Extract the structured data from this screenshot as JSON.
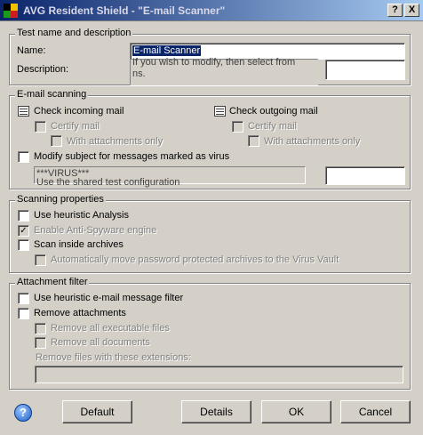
{
  "window": {
    "title": "AVG Resident Shield - \"E-mail Scanner\"",
    "help_label": "?",
    "close_label": "X"
  },
  "test_name": {
    "legend": "Test name and description",
    "name_label": "Name:",
    "name_value": "E-mail Scanner",
    "description_label": "Description:",
    "description_ghost_1": "If you wish to modify, then select from",
    "description_ghost_2": "ns."
  },
  "email_scanning": {
    "legend": "E-mail scanning",
    "check_incoming": "Check incoming mail",
    "check_outgoing": "Check outgoing mail",
    "certify_mail_in": "Certify mail",
    "certify_mail_out": "Certify mail",
    "with_attachments_in": "With attachments only",
    "with_attachments_out": "With attachments only",
    "modify_subject": "Modify subject for messages marked as virus",
    "subject_value": "***VIRUS***",
    "ghost_shared": "Use the shared test configuration"
  },
  "scanning_props": {
    "legend": "Scanning properties",
    "heuristic": "Use heuristic Analysis",
    "antispyware": "Enable Anti-Spyware engine",
    "inside_archives": "Scan inside archives",
    "move_password": "Automatically move password protected archives to the Virus Vault"
  },
  "attachment_filter": {
    "legend": "Attachment filter",
    "heuristic_filter": "Use heuristic e-mail message filter",
    "remove_attachments": "Remove attachments",
    "remove_executable": "Remove all executable files",
    "remove_documents": "Remove all documents",
    "extensions_label": "Remove files with these extensions:"
  },
  "buttons": {
    "default": "Default",
    "details": "Details",
    "ok": "OK",
    "cancel": "Cancel"
  }
}
